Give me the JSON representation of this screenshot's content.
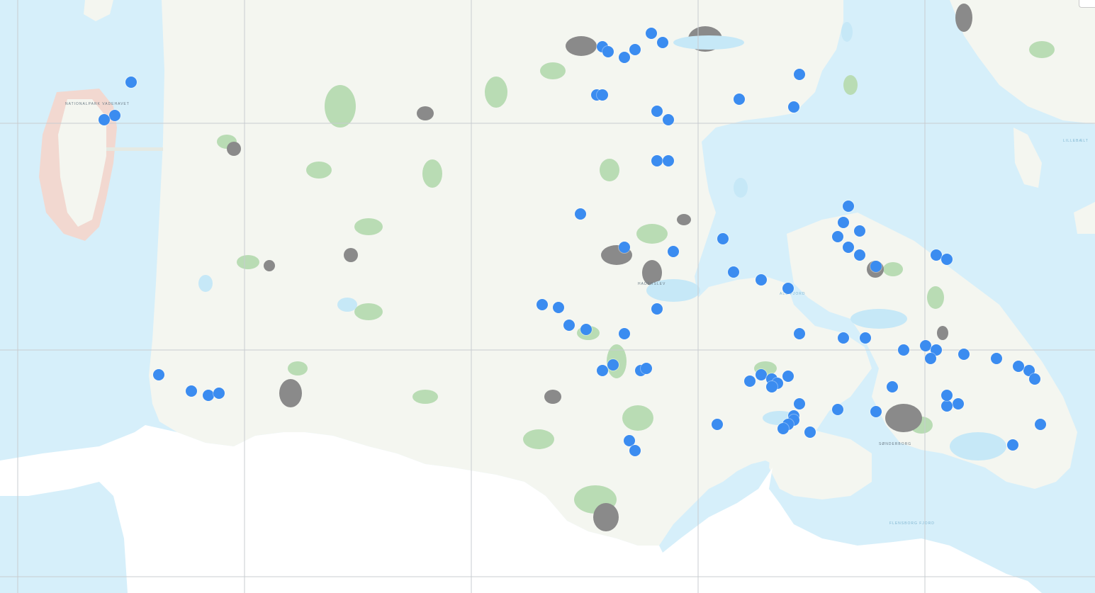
{
  "map": {
    "colors": {
      "sea": "#d6effa",
      "land": "#f4f6f0",
      "forest": "#b9dcb4",
      "town": "#8a8a8a",
      "water_inland": "#c6e8f7",
      "grid": "#c8ccd0",
      "marker": "#3b8cf0",
      "island_tint": "#f2d8d0"
    },
    "labels": {
      "island_north": "NATIONALPARK VADEHAVET",
      "fjord_flensburg": "FLENSBORG FJORD",
      "city_sonderborg": "SØNDERBORG",
      "sea_als": "ALS FJORD",
      "sea_haderslev": "HADERSLEV",
      "sea_right": "LILLEBÆLT"
    },
    "markers": [
      {
        "lat": 55.515,
        "lon": 9.47
      },
      {
        "lat": 55.498,
        "lon": 9.38
      },
      {
        "lat": 55.492,
        "lon": 9.39
      },
      {
        "lat": 55.485,
        "lon": 9.42
      },
      {
        "lat": 55.495,
        "lon": 9.44
      },
      {
        "lat": 55.503,
        "lon": 9.49
      },
      {
        "lat": 55.465,
        "lon": 9.74
      },
      {
        "lat": 55.435,
        "lon": 9.63
      },
      {
        "lat": 55.425,
        "lon": 9.73
      },
      {
        "lat": 55.44,
        "lon": 9.37
      },
      {
        "lat": 55.44,
        "lon": 9.38
      },
      {
        "lat": 55.42,
        "lon": 9.48
      },
      {
        "lat": 55.41,
        "lon": 9.5
      },
      {
        "lat": 55.455,
        "lon": 8.52
      },
      {
        "lat": 55.415,
        "lon": 8.49
      },
      {
        "lat": 55.41,
        "lon": 8.47
      },
      {
        "lat": 55.36,
        "lon": 9.48
      },
      {
        "lat": 55.36,
        "lon": 9.5
      },
      {
        "lat": 55.295,
        "lon": 9.34
      },
      {
        "lat": 55.255,
        "lon": 9.42
      },
      {
        "lat": 55.25,
        "lon": 9.51
      },
      {
        "lat": 55.265,
        "lon": 9.6
      },
      {
        "lat": 55.285,
        "lon": 9.82
      },
      {
        "lat": 55.305,
        "lon": 9.83
      },
      {
        "lat": 55.275,
        "lon": 9.85
      },
      {
        "lat": 55.268,
        "lon": 9.81
      },
      {
        "lat": 55.255,
        "lon": 9.83
      },
      {
        "lat": 55.245,
        "lon": 9.85
      },
      {
        "lat": 55.232,
        "lon": 9.88
      },
      {
        "lat": 55.245,
        "lon": 9.99
      },
      {
        "lat": 55.24,
        "lon": 10.01
      },
      {
        "lat": 55.225,
        "lon": 9.62
      },
      {
        "lat": 55.215,
        "lon": 9.67
      },
      {
        "lat": 55.205,
        "lon": 9.72
      },
      {
        "lat": 55.185,
        "lon": 9.27
      },
      {
        "lat": 55.182,
        "lon": 9.3
      },
      {
        "lat": 55.18,
        "lon": 9.48
      },
      {
        "lat": 55.15,
        "lon": 9.42
      },
      {
        "lat": 55.15,
        "lon": 9.74
      },
      {
        "lat": 55.145,
        "lon": 9.82
      },
      {
        "lat": 55.145,
        "lon": 9.86
      },
      {
        "lat": 55.13,
        "lon": 9.93
      },
      {
        "lat": 55.135,
        "lon": 9.97
      },
      {
        "lat": 55.13,
        "lon": 9.99
      },
      {
        "lat": 55.12,
        "lon": 9.98
      },
      {
        "lat": 55.125,
        "lon": 10.04
      },
      {
        "lat": 55.12,
        "lon": 10.1
      },
      {
        "lat": 55.105,
        "lon": 10.16
      },
      {
        "lat": 55.105,
        "lon": 9.45
      },
      {
        "lat": 55.108,
        "lon": 9.46
      },
      {
        "lat": 55.112,
        "lon": 9.4
      },
      {
        "lat": 55.1,
        "lon": 9.67
      },
      {
        "lat": 55.095,
        "lon": 9.69
      },
      {
        "lat": 55.09,
        "lon": 9.7
      },
      {
        "lat": 55.085,
        "lon": 9.69
      },
      {
        "lat": 55.098,
        "lon": 9.72
      },
      {
        "lat": 55.092,
        "lon": 9.65
      },
      {
        "lat": 55.065,
        "lon": 9.74
      },
      {
        "lat": 55.058,
        "lon": 9.81
      },
      {
        "lat": 55.05,
        "lon": 9.73
      },
      {
        "lat": 55.045,
        "lon": 9.73
      },
      {
        "lat": 55.04,
        "lon": 9.72
      },
      {
        "lat": 55.035,
        "lon": 9.71
      },
      {
        "lat": 55.03,
        "lon": 9.76
      },
      {
        "lat": 55.055,
        "lon": 9.88
      },
      {
        "lat": 55.085,
        "lon": 9.91
      },
      {
        "lat": 55.065,
        "lon": 10.03
      },
      {
        "lat": 55.062,
        "lon": 10.01
      },
      {
        "lat": 55.075,
        "lon": 10.01
      },
      {
        "lat": 55.11,
        "lon": 10.14
      },
      {
        "lat": 55.095,
        "lon": 10.17
      },
      {
        "lat": 55.04,
        "lon": 10.18
      },
      {
        "lat": 55.015,
        "lon": 10.13
      },
      {
        "lat": 55.04,
        "lon": 9.59
      },
      {
        "lat": 55.02,
        "lon": 9.43
      },
      {
        "lat": 55.008,
        "lon": 9.44
      },
      {
        "lat": 55.1,
        "lon": 8.57
      },
      {
        "lat": 55.08,
        "lon": 8.63
      },
      {
        "lat": 55.075,
        "lon": 8.66
      },
      {
        "lat": 55.078,
        "lon": 8.68
      },
      {
        "lat": 55.16,
        "lon": 9.32
      },
      {
        "lat": 55.155,
        "lon": 9.35
      },
      {
        "lat": 55.105,
        "lon": 9.38
      }
    ]
  }
}
